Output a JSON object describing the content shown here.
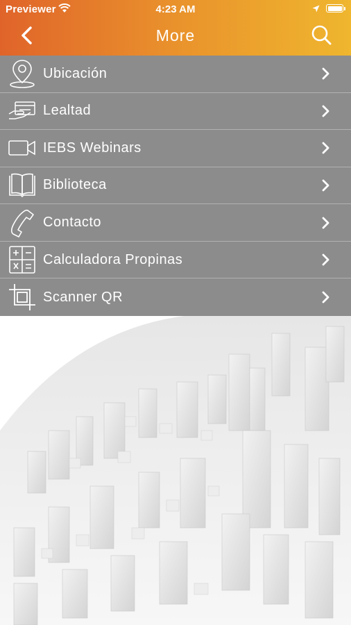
{
  "status_bar": {
    "carrier": "Previewer",
    "time": "4:23 AM",
    "icons": [
      "wifi-icon",
      "location-arrow-icon",
      "battery-icon"
    ]
  },
  "header": {
    "title": "More",
    "back_icon": "chevron-left-icon",
    "search_icon": "search-icon",
    "gradient_colors": [
      "#e0642a",
      "#efb62e"
    ]
  },
  "menu": {
    "background": "#8c8c8c",
    "items": [
      {
        "label": "Ubicación",
        "icon": "location-pin-icon"
      },
      {
        "label": "Lealtad",
        "icon": "loyalty-card-icon"
      },
      {
        "label": "IEBS Webinars",
        "icon": "video-camera-icon"
      },
      {
        "label": "Biblioteca",
        "icon": "book-icon"
      },
      {
        "label": "Contacto",
        "icon": "phone-icon"
      },
      {
        "label": "Calculadora Propinas",
        "icon": "calculator-icon"
      },
      {
        "label": "Scanner QR",
        "icon": "crop-icon"
      }
    ]
  },
  "background": {
    "image": "city-skyline-illustration"
  }
}
